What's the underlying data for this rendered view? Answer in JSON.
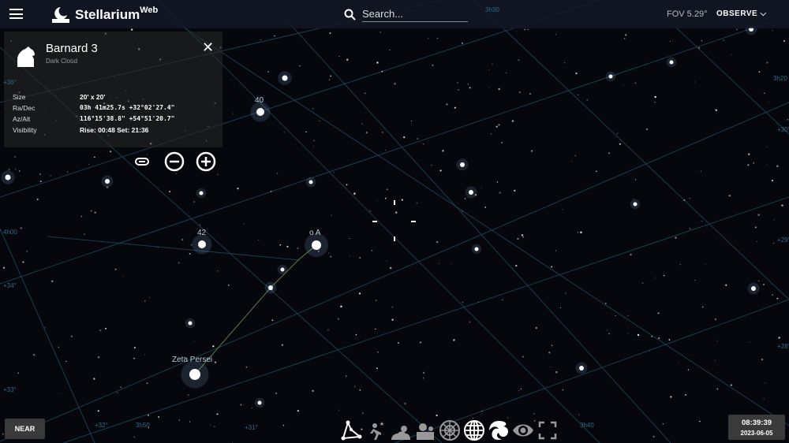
{
  "app": {
    "name": "Stellarium",
    "name_sup": "Web"
  },
  "search": {
    "placeholder": "Search..."
  },
  "fov": "FOV 5.29°",
  "observe_label": "OBSERVE",
  "selected_object": {
    "name": "Barnard 3",
    "type": "Dark Cloud",
    "rows": [
      {
        "label": "Size",
        "value": "20' x 20'"
      },
      {
        "label": "Ra/Dec",
        "value": "03h 41m25.7s  +32°02'27.4\""
      },
      {
        "label": "Az/Alt",
        "value": "116°15'38.8\"  +54°51'20.7\""
      },
      {
        "label": "Visibility",
        "value": "Rise: 00:48   Set: 21:36"
      }
    ]
  },
  "sky_labels": {
    "s40": "40",
    "s42": "42",
    "oA": "o A",
    "zeta": "Zeta Persei"
  },
  "grid_labels": [
    "+36°",
    "+34°",
    "+33°",
    "+32°",
    "+31°",
    "+30°",
    "+29°",
    "+28°",
    "4h00",
    "3h50",
    "3h40",
    "3h30",
    "3h20"
  ],
  "near_label": "NEAR",
  "toolbar": [
    "constellations",
    "atmosphere",
    "landscape",
    "ground",
    "azimuthal-grid",
    "equatorial-grid",
    "deep-sky-objects",
    "night-mode",
    "fullscreen"
  ],
  "clock": {
    "time": "08:39:39",
    "date": "2023-06-05"
  }
}
